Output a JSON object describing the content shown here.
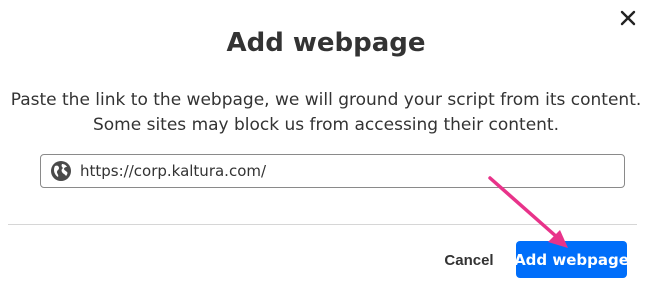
{
  "dialog": {
    "close_icon": "close-icon",
    "title": "Add webpage",
    "description_line1": "Paste the link to the webpage, we will ground your script from its content.",
    "description_line2": "Some sites may block us from accessing their content.",
    "url_field": {
      "icon": "globe-icon",
      "value": "https://corp.kaltura.com/",
      "placeholder": ""
    },
    "cancel_label": "Cancel",
    "submit_label": "Add webpage"
  },
  "colors": {
    "primary": "#006efa",
    "annotation_arrow": "#e8338a"
  }
}
